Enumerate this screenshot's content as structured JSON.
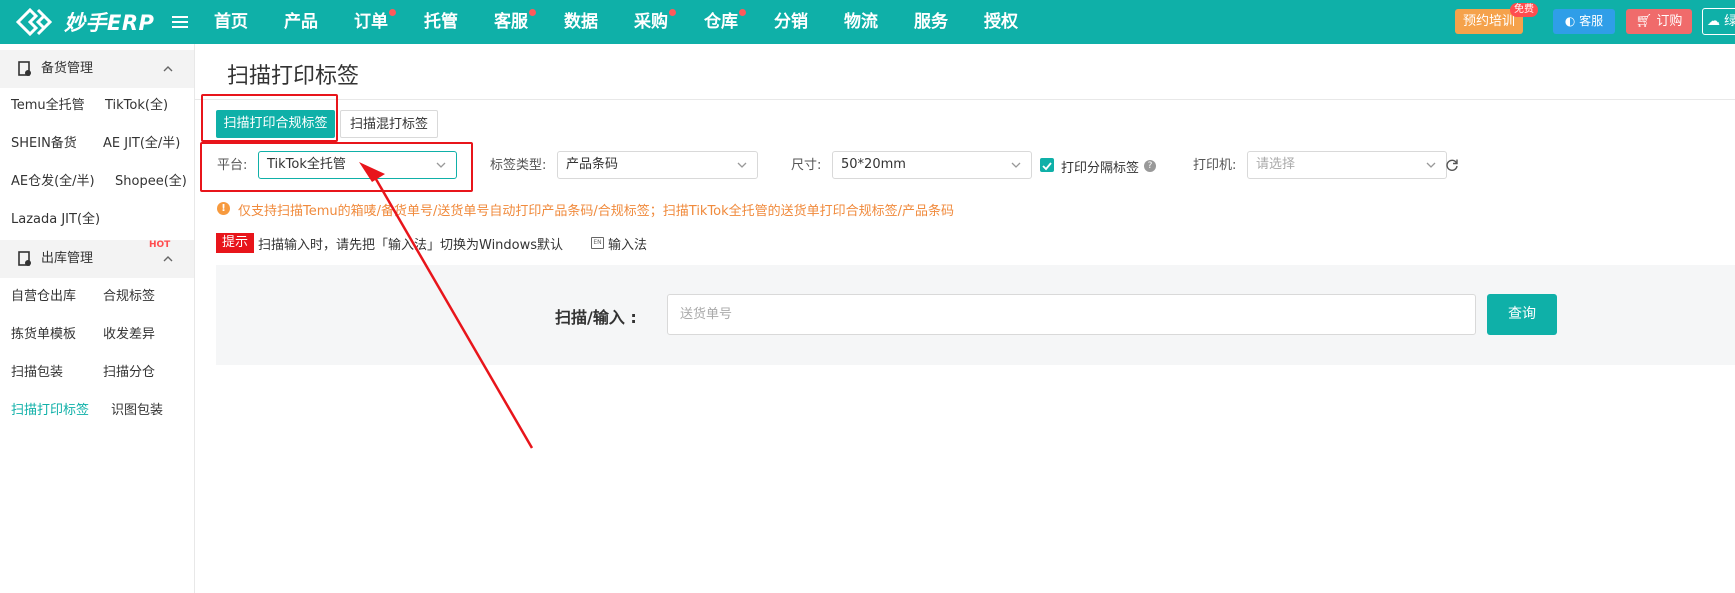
{
  "app": {
    "logo_text": "妙手ERP"
  },
  "nav": [
    {
      "label": "首页",
      "dot": false
    },
    {
      "label": "产品",
      "dot": false
    },
    {
      "label": "订单",
      "dot": true
    },
    {
      "label": "托管",
      "dot": false
    },
    {
      "label": "客服",
      "dot": true
    },
    {
      "label": "数据",
      "dot": false
    },
    {
      "label": "采购",
      "dot": true
    },
    {
      "label": "仓库",
      "dot": true
    },
    {
      "label": "分销",
      "dot": false
    },
    {
      "label": "物流",
      "dot": false
    },
    {
      "label": "服务",
      "dot": false
    },
    {
      "label": "授权",
      "dot": false
    }
  ],
  "header_actions": {
    "training_label": "预约培训",
    "free_badge": "免费",
    "service_label": "客服",
    "order_label": "订购",
    "cloud_label": "绿"
  },
  "sidebar": {
    "group1": {
      "label": "备货管理",
      "items": [
        "Temu全托管",
        "TikTok(全)",
        "SHEIN备货",
        "AE JIT(全/半)",
        "AE仓发(全/半)",
        "Shopee(全)",
        "Lazada JIT(全)"
      ]
    },
    "group2": {
      "label": "出库管理",
      "items": [
        "自营仓出库",
        "合规标签",
        "拣货单模板",
        "收发差异",
        "扫描包装",
        "扫描分仓",
        "扫描打印标签",
        "识图包装"
      ],
      "hot_badge": "HOT"
    }
  },
  "page": {
    "title": "扫描打印标签",
    "tabs": [
      "扫描打印合规标签",
      "扫描混打标签"
    ],
    "filters": {
      "platform_label": "平台:",
      "platform_value": "TikTok全托管",
      "label_type_label": "标签类型:",
      "label_type_value": "产品条码",
      "size_label": "尺寸:",
      "size_value": "50*20mm",
      "print_separator_label": "打印分隔标签",
      "printer_label": "打印机:",
      "printer_placeholder": "请选择"
    },
    "notice": "仅支持扫描Temu的箱唛/备货单号/送货单号自动打印产品条码/合规标签；扫描TikTok全托管的送货单打印合规标签/产品条码",
    "tip_badge": "提示",
    "tip_text": "扫描输入时，请先把「输入法」切换为Windows默认",
    "tip_tail": "输入法",
    "scan_label": "扫描/输入 :",
    "scan_placeholder": "送货单号",
    "query_label": "查询"
  },
  "colors": {
    "brand": "#0fb0a8",
    "annotation": "#e8151b",
    "notice": "#f08a3c"
  }
}
